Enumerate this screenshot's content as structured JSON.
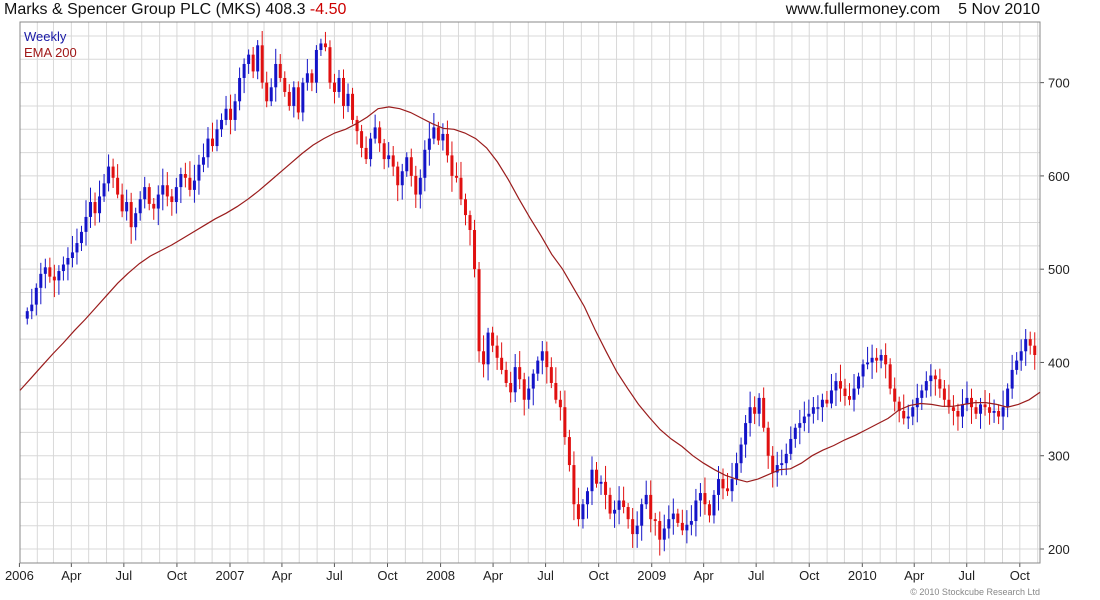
{
  "header": {
    "title": "Marks & Spencer Group PLC (MKS)",
    "last": "408.3",
    "change": "-4.50",
    "site": "www.fullermoney.com",
    "date": "5 Nov 2010"
  },
  "legend": {
    "weekly": "Weekly",
    "ema": "EMA 200"
  },
  "credit": "© 2010 Stockcube Research Ltd",
  "colors": {
    "up": "#1414c8",
    "down": "#e01010",
    "ema": "#9a1c1c",
    "grid": "#d8d8d8"
  },
  "chart_data": {
    "type": "candlestick",
    "frequency": "weekly",
    "xlim": [
      "2006-01-02",
      "2010-11-05"
    ],
    "ylim": [
      185,
      765
    ],
    "yticks": [
      200,
      300,
      400,
      500,
      600,
      700
    ],
    "xtick_labels": [
      {
        "date": "2006-01-01",
        "label": "2006"
      },
      {
        "date": "2006-04-01",
        "label": "Apr"
      },
      {
        "date": "2006-07-01",
        "label": "Jul"
      },
      {
        "date": "2006-10-01",
        "label": "Oct"
      },
      {
        "date": "2007-01-01",
        "label": "2007"
      },
      {
        "date": "2007-04-01",
        "label": "Apr"
      },
      {
        "date": "2007-07-01",
        "label": "Jul"
      },
      {
        "date": "2007-10-01",
        "label": "Oct"
      },
      {
        "date": "2008-01-01",
        "label": "2008"
      },
      {
        "date": "2008-04-01",
        "label": "Apr"
      },
      {
        "date": "2008-07-01",
        "label": "Jul"
      },
      {
        "date": "2008-10-01",
        "label": "Oct"
      },
      {
        "date": "2009-01-01",
        "label": "2009"
      },
      {
        "date": "2009-04-01",
        "label": "Apr"
      },
      {
        "date": "2009-07-01",
        "label": "Jul"
      },
      {
        "date": "2009-10-01",
        "label": "Oct"
      },
      {
        "date": "2010-01-01",
        "label": "2010"
      },
      {
        "date": "2010-04-01",
        "label": "Apr"
      },
      {
        "date": "2010-07-01",
        "label": "Jul"
      },
      {
        "date": "2010-10-01",
        "label": "Oct"
      }
    ],
    "series": [
      {
        "name": "Weekly",
        "kind": "candles",
        "closes": [
          455,
          462,
          480,
          495,
          502,
          492,
          488,
          498,
          505,
          512,
          518,
          528,
          540,
          556,
          572,
          560,
          578,
          592,
          610,
          598,
          580,
          562,
          572,
          545,
          560,
          575,
          588,
          570,
          565,
          580,
          590,
          578,
          572,
          588,
          602,
          598,
          585,
          595,
          612,
          620,
          640,
          632,
          650,
          660,
          672,
          660,
          680,
          705,
          720,
          730,
          712,
          740,
          700,
          680,
          695,
          720,
          705,
          690,
          675,
          695,
          668,
          700,
          710,
          700,
          735,
          742,
          738,
          700,
          690,
          705,
          675,
          688,
          660,
          648,
          630,
          618,
          640,
          652,
          635,
          618,
          622,
          610,
          590,
          605,
          620,
          600,
          580,
          598,
          628,
          640,
          652,
          638,
          645,
          622,
          600,
          598,
          575,
          558,
          542,
          500,
          412,
          398,
          432,
          418,
          405,
          392,
          378,
          368,
          395,
          382,
          360,
          372,
          388,
          402,
          412,
          395,
          378,
          360,
          352,
          320,
          290,
          248,
          232,
          248,
          262,
          285,
          270,
          272,
          258,
          238,
          242,
          252,
          245,
          232,
          216,
          225,
          248,
          258,
          232,
          230,
          210,
          222,
          232,
          238,
          228,
          220,
          226,
          230,
          252,
          260,
          248,
          236,
          258,
          275,
          265,
          262,
          275,
          292,
          312,
          335,
          352,
          345,
          362,
          330,
          300,
          282,
          290,
          292,
          302,
          318,
          330,
          335,
          342,
          345,
          352,
          352,
          360,
          356,
          370,
          380,
          372,
          364,
          360,
          372,
          385,
          398,
          400,
          405,
          402,
          408,
          398,
          372,
          358,
          348,
          340,
          342,
          352,
          362,
          370,
          380,
          386,
          382,
          372,
          360,
          352,
          348,
          342,
          355,
          362,
          352,
          345,
          355,
          352,
          346,
          348,
          342,
          352,
          372,
          392,
          402,
          412,
          425,
          418,
          408
        ]
      },
      {
        "name": "EMA 200",
        "kind": "line",
        "values": [
          370,
          383,
          396,
          409,
          421,
          434,
          446,
          459,
          472,
          485,
          496,
          506,
          514,
          520,
          526,
          533,
          540,
          547,
          554,
          560,
          567,
          575,
          584,
          594,
          604,
          614,
          624,
          633,
          640,
          646,
          650,
          656,
          663,
          672,
          674,
          672,
          668,
          662,
          656,
          651,
          650,
          646,
          640,
          630,
          615,
          596,
          575,
          555,
          536,
          516,
          500,
          480,
          460,
          435,
          412,
          390,
          372,
          355,
          341,
          328,
          318,
          310,
          300,
          292,
          285,
          279,
          275,
          272,
          275,
          280,
          285,
          286,
          292,
          300,
          306,
          311,
          317,
          322,
          328,
          334,
          340,
          349,
          354,
          356,
          355,
          353,
          353,
          355,
          357,
          357,
          355,
          352,
          355,
          360,
          368
        ]
      }
    ]
  }
}
